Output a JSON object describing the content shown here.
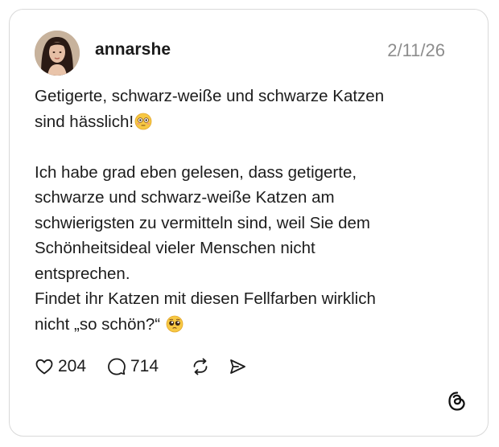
{
  "post": {
    "username": "annarshe",
    "date": "2/11/26",
    "paragraph1_line1": "Getigerte, schwarz-weiße und schwarze Katzen",
    "paragraph1_line2": "sind hässlich!",
    "body_lines": [
      "Ich habe grad eben gelesen, dass getigerte,",
      "schwarze und schwarz-weiße Katzen am",
      "schwierigsten zu vermitteln sind, weil Sie dem",
      "Schönheitsideal vieler Menschen nicht",
      "entsprechen.",
      "Findet ihr Katzen mit diesen Fellfarben wirklich"
    ],
    "last_line": "nicht „so schön?“",
    "emoji_1": "flushed-face-emoji",
    "emoji_2": "pleading-face-emoji"
  },
  "actions": {
    "likes": "204",
    "comments": "714",
    "like_icon": "heart-icon",
    "comment_icon": "comment-icon",
    "repost_icon": "repost-icon",
    "share_icon": "share-icon"
  },
  "brand": {
    "logo": "threads-logo-icon"
  },
  "colors": {
    "text": "#1c1c1c",
    "muted": "#8d8d8d",
    "border": "#d9d9d9",
    "emoji_yellow": "#f7c843"
  }
}
